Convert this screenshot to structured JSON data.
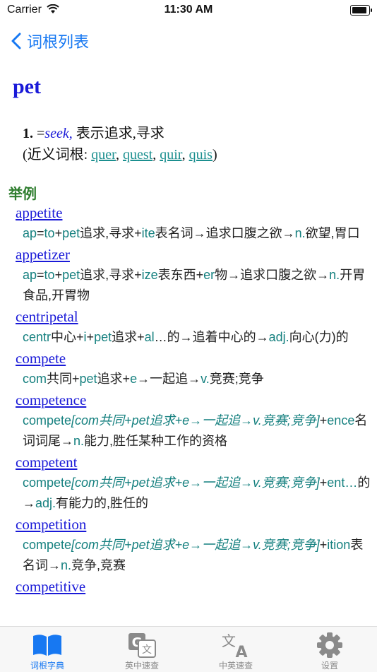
{
  "status_bar": {
    "carrier": "Carrier",
    "time": "11:30 AM"
  },
  "nav": {
    "back_label": "词根列表"
  },
  "headword": "pet",
  "sense": {
    "number": "1.",
    "eq": "=",
    "seek": "seek,",
    "meaning": " 表示追求,寻求",
    "near_prefix": "(近义词根: ",
    "near_roots": [
      "quer",
      "quest",
      "quir",
      "quis"
    ],
    "near_suffix": ")"
  },
  "section_title": "举例",
  "examples": [
    {
      "word": "appetite",
      "parts": [
        [
          "g",
          "ap"
        ],
        [
          "n",
          "="
        ],
        [
          "g",
          "to"
        ],
        [
          "n",
          "+"
        ],
        [
          "g",
          "pet"
        ],
        [
          "n",
          "追求,寻求+"
        ],
        [
          "g",
          "ite"
        ],
        [
          "n",
          "表名词→追求口腹之欲→"
        ],
        [
          "g",
          "n."
        ],
        [
          "n",
          "欲望,胃口"
        ]
      ]
    },
    {
      "word": "appetizer",
      "parts": [
        [
          "g",
          "ap"
        ],
        [
          "n",
          "="
        ],
        [
          "g",
          "to"
        ],
        [
          "n",
          "+"
        ],
        [
          "g",
          "pet"
        ],
        [
          "n",
          "追求,寻求+"
        ],
        [
          "g",
          "ize"
        ],
        [
          "n",
          "表东西+"
        ],
        [
          "g",
          "er"
        ],
        [
          "n",
          "物→追求口腹之欲→"
        ],
        [
          "g",
          "n."
        ],
        [
          "n",
          "开胃食品,开胃物"
        ]
      ]
    },
    {
      "word": "centripetal",
      "parts": [
        [
          "g",
          "centr"
        ],
        [
          "n",
          "中心+"
        ],
        [
          "g",
          "i"
        ],
        [
          "n",
          "+"
        ],
        [
          "g",
          "pet"
        ],
        [
          "n",
          "追求+"
        ],
        [
          "g",
          "al"
        ],
        [
          "n",
          "…的→追着中心的→"
        ],
        [
          "g",
          "adj."
        ],
        [
          "n",
          "向心(力)的"
        ]
      ]
    },
    {
      "word": "compete",
      "parts": [
        [
          "g",
          "com"
        ],
        [
          "n",
          "共同+"
        ],
        [
          "g",
          "pet"
        ],
        [
          "n",
          "追求+"
        ],
        [
          "g",
          "e"
        ],
        [
          "n",
          "→一起追→"
        ],
        [
          "g",
          "v."
        ],
        [
          "n",
          "竞赛;竞争"
        ]
      ]
    },
    {
      "word": "competence",
      "parts": [
        [
          "g",
          "compete"
        ],
        [
          "i",
          "[com共同+pet追求+e→一起追→v.竞赛;竞争]"
        ],
        [
          "n",
          "+"
        ],
        [
          "g",
          "ence"
        ],
        [
          "n",
          "名词词尾→"
        ],
        [
          "g",
          "n."
        ],
        [
          "n",
          "能力,胜任某种工作的资格"
        ]
      ]
    },
    {
      "word": "competent",
      "parts": [
        [
          "g",
          "compete"
        ],
        [
          "i",
          "[com共同+pet追求+e→一起追→v.竞赛;竞争]"
        ],
        [
          "n",
          "+"
        ],
        [
          "g",
          "ent…"
        ],
        [
          "n",
          "的→"
        ],
        [
          "g",
          "adj."
        ],
        [
          "n",
          "有能力的,胜任的"
        ]
      ]
    },
    {
      "word": "competition",
      "parts": [
        [
          "g",
          "compete"
        ],
        [
          "i",
          "[com共同+pet追求+e→一起追→v.竞赛;竞争]"
        ],
        [
          "n",
          "+"
        ],
        [
          "g",
          "ition"
        ],
        [
          "n",
          "表名词→"
        ],
        [
          "g",
          "n."
        ],
        [
          "n",
          "竞争,竞赛"
        ]
      ]
    },
    {
      "word": "competitive",
      "parts": []
    }
  ],
  "tabs": [
    {
      "label": "词根字典",
      "icon": "book-icon",
      "active": true
    },
    {
      "label": "英中速查",
      "icon": "translate-g-icon",
      "active": false
    },
    {
      "label": "中英速查",
      "icon": "translate-a-icon",
      "active": false
    },
    {
      "label": "设置",
      "icon": "gear-icon",
      "active": false
    }
  ],
  "colors": {
    "accent": "#1778f2",
    "headword": "#1a1ad8",
    "root": "#15807f",
    "section": "#2e7d2e"
  }
}
